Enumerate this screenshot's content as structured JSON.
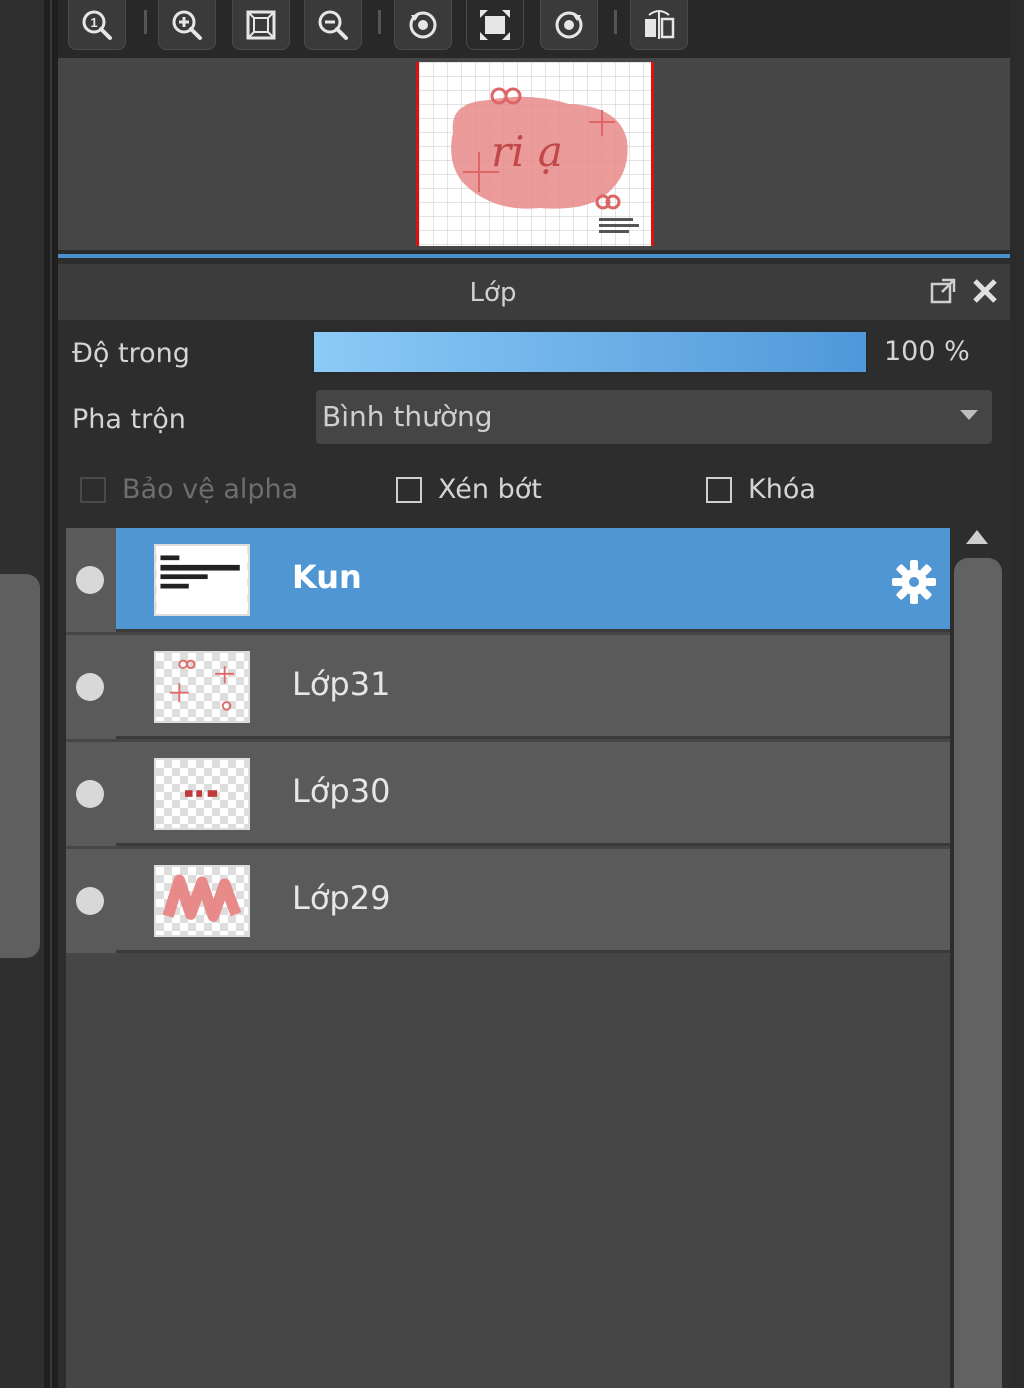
{
  "toolbar": {
    "buttons": [
      {
        "name": "zoom-actual-icon"
      },
      {
        "name": "zoom-in-icon"
      },
      {
        "name": "fit-window-icon"
      },
      {
        "name": "zoom-out-icon"
      },
      {
        "name": "rotate-left-icon"
      },
      {
        "name": "reset-rotation-icon"
      },
      {
        "name": "rotate-right-icon"
      },
      {
        "name": "flip-horizontal-icon"
      }
    ]
  },
  "navigator": {
    "preview_text": "ri ạ"
  },
  "layer_panel": {
    "title": "Lớp",
    "opacity_label": "Độ trong",
    "opacity_percent": 100,
    "opacity_value": "100 %",
    "blend_label": "Pha trộn",
    "blend_value": "Bình thường",
    "checkboxes": [
      {
        "label": "Bảo vệ alpha",
        "checked": false,
        "enabled": false
      },
      {
        "label": "Xén bớt",
        "checked": false,
        "enabled": true
      },
      {
        "label": "Khóa",
        "checked": false,
        "enabled": true
      }
    ],
    "layers": [
      {
        "name": "Kun",
        "selected": true,
        "visible": true
      },
      {
        "name": "Lớp31",
        "selected": false,
        "visible": true
      },
      {
        "name": "Lớp30",
        "selected": false,
        "visible": true
      },
      {
        "name": "Lớp29",
        "selected": false,
        "visible": true
      }
    ]
  },
  "colors": {
    "accent": "#4f96d3",
    "opacity_bar_start": "#8ccaf7",
    "opacity_bar_end": "#4f98d9",
    "canvas_border": "#dd1111",
    "artwork_pink": "#e98a8a"
  }
}
